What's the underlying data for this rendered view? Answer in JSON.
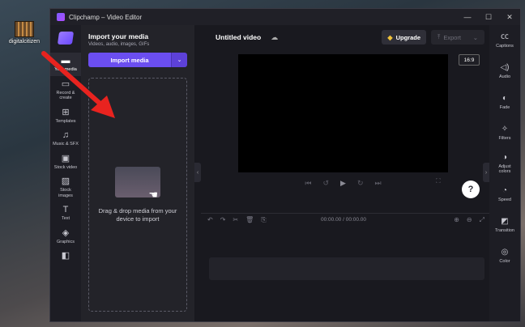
{
  "desktop": {
    "icon_label": "digitalcitizen"
  },
  "window": {
    "title": "Clipchamp – Video Editor"
  },
  "left_rail": {
    "items": [
      {
        "label": "Your media",
        "icon": "folder-icon"
      },
      {
        "label": "Record &\ncreate",
        "icon": "camera-icon"
      },
      {
        "label": "Templates",
        "icon": "templates-icon"
      },
      {
        "label": "Music & SFX",
        "icon": "music-icon"
      },
      {
        "label": "Stock video",
        "icon": "film-icon"
      },
      {
        "label": "Stock\nimages",
        "icon": "image-icon"
      },
      {
        "label": "Text",
        "icon": "text-icon"
      },
      {
        "label": "Graphics",
        "icon": "shapes-icon"
      }
    ]
  },
  "media_panel": {
    "title": "Import your media",
    "subtitle": "Videos, audio, images, GIFs",
    "import_label": "Import media",
    "dropzone_text": "Drag & drop media from your device to import"
  },
  "editor": {
    "project_name": "Untitled video",
    "upgrade_label": "Upgrade",
    "export_label": "Export",
    "aspect_ratio": "16:9",
    "help_label": "?",
    "timecode": "00:00.00 / 00:00.00"
  },
  "right_rail": {
    "items": [
      {
        "label": "Captions",
        "icon": "captions-icon"
      },
      {
        "label": "Audio",
        "icon": "speaker-icon"
      },
      {
        "label": "Fade",
        "icon": "fade-icon"
      },
      {
        "label": "Filters",
        "icon": "wand-icon"
      },
      {
        "label": "Adjust\ncolors",
        "icon": "contrast-icon"
      },
      {
        "label": "Speed",
        "icon": "speed-icon"
      },
      {
        "label": "Transition",
        "icon": "transition-icon"
      },
      {
        "label": "Color",
        "icon": "palette-icon"
      }
    ]
  },
  "colors": {
    "accent": "#6b4ef0",
    "arrow": "#e8231f"
  }
}
